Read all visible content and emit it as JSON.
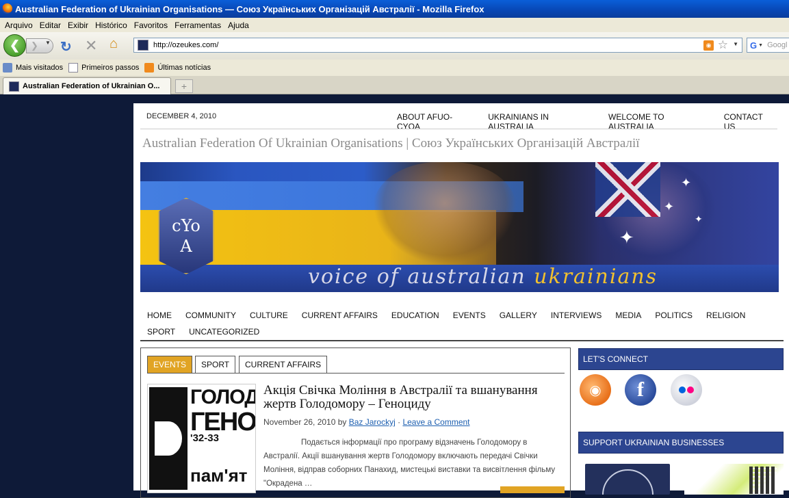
{
  "window": {
    "title": "Australian Federation of Ukrainian Organisations — Союз Українських Організацій Австралії - Mozilla Firefox"
  },
  "menu": [
    "Arquivo",
    "Editar",
    "Exibir",
    "Histórico",
    "Favoritos",
    "Ferramentas",
    "Ajuda"
  ],
  "navigation": {
    "url": "http://ozeukes.com/",
    "search_placeholder": "Googl"
  },
  "bookmarks": [
    "Mais visitados",
    "Primeiros passos",
    "Últimas notícias"
  ],
  "tabs": [
    {
      "label": "Australian Federation of Ukrainian O..."
    }
  ],
  "site": {
    "date": "DECEMBER 4, 2010",
    "top_nav": [
      "ABOUT AFUO-CYOA",
      "UKRAINIANS IN AUSTRALIA",
      "WELCOME TO AUSTRALIA",
      "CONTACT US"
    ],
    "title": "Australian Federation Of Ukrainian Organisations  |  Союз Українських Організацій Австралії",
    "banner": {
      "tagline_part1": "voice of australian ",
      "tagline_part2": "ukrainians",
      "logo_line1": "cYo",
      "logo_line2": "A"
    },
    "main_nav": [
      "HOME",
      "COMMUNITY",
      "CULTURE",
      "CURRENT AFFAIRS",
      "EDUCATION",
      "EVENTS",
      "GALLERY",
      "INTERVIEWS",
      "MEDIA",
      "POLITICS",
      "RELIGION",
      "SPORT",
      "UNCATEGORIZED"
    ],
    "content_tabs": [
      "EVENTS",
      "SPORT",
      "CURRENT AFFAIRS"
    ],
    "post": {
      "thumb_lines": [
        "ГОЛОД",
        "ГЕНО",
        "'32-33",
        "пам'ят"
      ],
      "title": "Акція Свічка Моління в Австралії та вшанування жертв Голодомору – Геноциду",
      "date": "November 26, 2010",
      "by": " by ",
      "author": "Baz Jarockyj",
      "sep": " · ",
      "comment_link": "Leave a Comment",
      "excerpt": "Подається  інформації про програму відзначень Голодомору в Австралії.   Акції вшанування жертв Голодомору включають передачі Свічки Моління, відправ соборних Панахид, мистецькі виставки та висвітлення фільму \"Окрадена …"
    },
    "sidebar": {
      "connect_title": "LET'S CONNECT",
      "business_title": "SUPPORT UKRAINIAN BUSINESSES"
    }
  },
  "colors": {
    "accent": "#e1a424",
    "sidebar_header": "#2c4590",
    "page_bg": "#0e1a38"
  }
}
